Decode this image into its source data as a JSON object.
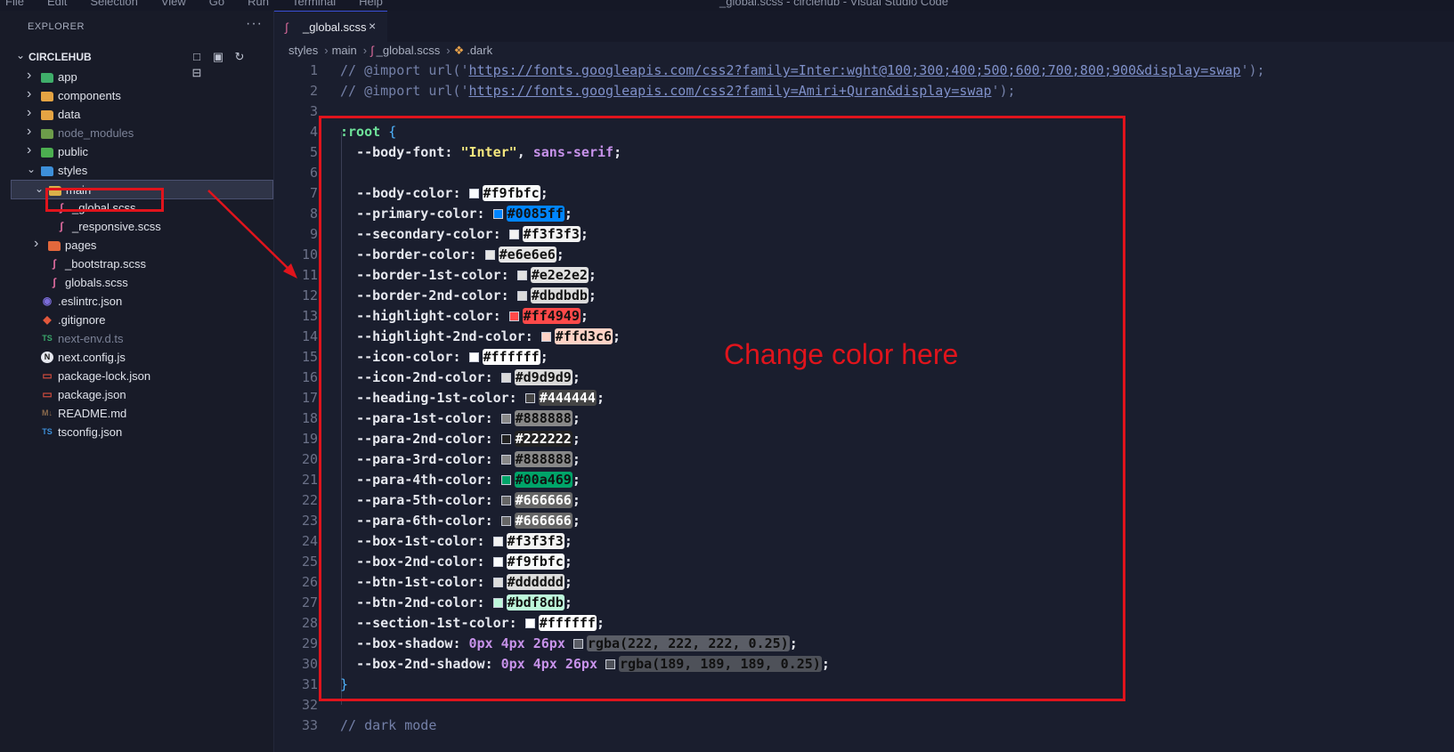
{
  "window": {
    "menu": [
      "File",
      "Edit",
      "Selection",
      "View",
      "Go",
      "Run",
      "Terminal",
      "Help"
    ],
    "title": "_global.scss - circlehub - Visual Studio Code"
  },
  "explorer": {
    "header": "EXPLORER",
    "more": "···",
    "project": "CIRCLEHUB",
    "items": [
      {
        "label": "app",
        "type": "folder",
        "icon_color": "#3fae6a",
        "depth": 1,
        "expanded": false
      },
      {
        "label": "components",
        "type": "folder",
        "icon_color": "#e5a443",
        "depth": 1,
        "expanded": false
      },
      {
        "label": "data",
        "type": "folder",
        "icon_color": "#e5a443",
        "depth": 1,
        "expanded": false
      },
      {
        "label": "node_modules",
        "type": "folder",
        "icon_color": "#6c9c4a",
        "depth": 1,
        "expanded": false,
        "dim": true
      },
      {
        "label": "public",
        "type": "folder",
        "icon_color": "#4caf50",
        "depth": 1,
        "expanded": false
      },
      {
        "label": "styles",
        "type": "folder",
        "icon_color": "#3d8fd9",
        "depth": 1,
        "expanded": true
      },
      {
        "label": "main",
        "type": "folder",
        "icon_color": "#d9b04a",
        "depth": 2,
        "expanded": true,
        "selected": true
      },
      {
        "label": "_global.scss",
        "type": "scss",
        "icon_color": "#e06c9f",
        "depth": 3
      },
      {
        "label": "_responsive.scss",
        "type": "scss",
        "icon_color": "#e06c9f",
        "depth": 3
      },
      {
        "label": "pages",
        "type": "folder",
        "icon_color": "#e2683c",
        "depth": 2,
        "expanded": false
      },
      {
        "label": "_bootstrap.scss",
        "type": "scss",
        "icon_color": "#e06c9f",
        "depth": 2
      },
      {
        "label": "globals.scss",
        "type": "scss",
        "icon_color": "#e06c9f",
        "depth": 2
      },
      {
        "label": ".eslintrc.json",
        "type": "eslint",
        "icon_color": "#7b6cd9",
        "depth": 1
      },
      {
        "label": ".gitignore",
        "type": "git",
        "icon_color": "#e2583c",
        "depth": 1
      },
      {
        "label": "next-env.d.ts",
        "type": "ts",
        "icon_color": "#3aa86b",
        "depth": 1,
        "dim": true
      },
      {
        "label": "next.config.js",
        "type": "next",
        "icon_color": "#c8ccd8",
        "depth": 1
      },
      {
        "label": "package-lock.json",
        "type": "npm",
        "icon_color": "#c84a3c",
        "depth": 1
      },
      {
        "label": "package.json",
        "type": "npm",
        "icon_color": "#c84a3c",
        "depth": 1
      },
      {
        "label": "README.md",
        "type": "md",
        "icon_color": "#8a6a4c",
        "depth": 1
      },
      {
        "label": "tsconfig.json",
        "type": "tsconfig",
        "icon_color": "#3d8fd9",
        "depth": 1
      }
    ]
  },
  "tab": {
    "label": "_global.scss",
    "close": "×"
  },
  "breadcrumb": [
    "styles",
    "main",
    "_global.scss",
    ".dark"
  ],
  "code": {
    "line1": {
      "pre": "// @import url('",
      "url": "https://fonts.googleapis.com/css2?family=Inter:wght@100;300;400;500;600;700;800;900&display=swap",
      "post": "');"
    },
    "line2": {
      "pre": "// @import url('",
      "url": "https://fonts.googleapis.com/css2?family=Amiri+Quran&display=swap",
      "post": "');"
    },
    "selector": ":root",
    "open_brace": "{",
    "close_brace": "}",
    "body_font": {
      "name": "--body-font",
      "str": "\"Inter\"",
      "kw": "sans-serif"
    },
    "vars": [
      {
        "line": 7,
        "name": "--body-color",
        "value": "#f9fbfc",
        "bg": "#f9fbfc",
        "fg": "#111111"
      },
      {
        "line": 8,
        "name": "--primary-color",
        "value": "#0085ff",
        "bg": "#0085ff",
        "fg": "#111111"
      },
      {
        "line": 9,
        "name": "--secondary-color",
        "value": "#f3f3f3",
        "bg": "#f3f3f3",
        "fg": "#111111"
      },
      {
        "line": 10,
        "name": "--border-color",
        "value": "#e6e6e6",
        "bg": "#e6e6e6",
        "fg": "#111111"
      },
      {
        "line": 11,
        "name": "--border-1st-color",
        "value": "#e2e2e2",
        "bg": "#e2e2e2",
        "fg": "#111111"
      },
      {
        "line": 12,
        "name": "--border-2nd-color",
        "value": "#dbdbdb",
        "bg": "#dbdbdb",
        "fg": "#111111"
      },
      {
        "line": 13,
        "name": "--highlight-color",
        "value": "#ff4949",
        "bg": "#ff4949",
        "fg": "#111111"
      },
      {
        "line": 14,
        "name": "--highlight-2nd-color",
        "value": "#ffd3c6",
        "bg": "#ffd3c6",
        "fg": "#111111"
      },
      {
        "line": 15,
        "name": "--icon-color",
        "value": "#ffffff",
        "bg": "#ffffff",
        "fg": "#111111"
      },
      {
        "line": 16,
        "name": "--icon-2nd-color",
        "value": "#d9d9d9",
        "bg": "#d9d9d9",
        "fg": "#111111"
      },
      {
        "line": 17,
        "name": "--heading-1st-color",
        "value": "#444444",
        "bg": "#444444",
        "fg": "#ffffff"
      },
      {
        "line": 18,
        "name": "--para-1st-color",
        "value": "#888888",
        "bg": "#888888",
        "fg": "#111111"
      },
      {
        "line": 19,
        "name": "--para-2nd-color",
        "value": "#222222",
        "bg": "#222222",
        "fg": "#ffffff"
      },
      {
        "line": 20,
        "name": "--para-3rd-color",
        "value": "#888888",
        "bg": "#888888",
        "fg": "#111111"
      },
      {
        "line": 21,
        "name": "--para-4th-color",
        "value": "#00a469",
        "bg": "#00a469",
        "fg": "#111111"
      },
      {
        "line": 22,
        "name": "--para-5th-color",
        "value": "#666666",
        "bg": "#666666",
        "fg": "#ffffff"
      },
      {
        "line": 23,
        "name": "--para-6th-color",
        "value": "#666666",
        "bg": "#666666",
        "fg": "#ffffff"
      },
      {
        "line": 24,
        "name": "--box-1st-color",
        "value": "#f3f3f3",
        "bg": "#f3f3f3",
        "fg": "#111111"
      },
      {
        "line": 25,
        "name": "--box-2nd-color",
        "value": "#f9fbfc",
        "bg": "#f9fbfc",
        "fg": "#111111"
      },
      {
        "line": 26,
        "name": "--btn-1st-color",
        "value": "#dddddd",
        "bg": "#dddddd",
        "fg": "#111111"
      },
      {
        "line": 27,
        "name": "--btn-2nd-color",
        "value": "#bdf8db",
        "bg": "#bdf8db",
        "fg": "#111111"
      },
      {
        "line": 28,
        "name": "--section-1st-color",
        "value": "#ffffff",
        "bg": "#ffffff",
        "fg": "#111111"
      }
    ],
    "shadows": [
      {
        "line": 29,
        "name": "--box-shadow",
        "nums": "0px 4px 26px",
        "value": "rgba(222, 222, 222, 0.25)",
        "bg": "#5a5d66",
        "fg": "#111111"
      },
      {
        "line": 30,
        "name": "--box-2nd-shadow",
        "nums": "0px 4px 26px",
        "value": "rgba(189, 189, 189, 0.25)",
        "bg": "#4e5159",
        "fg": "#111111"
      }
    ],
    "line33": "// dark mode"
  },
  "annotation": {
    "text": "Change color here",
    "color": "#e0141c"
  }
}
